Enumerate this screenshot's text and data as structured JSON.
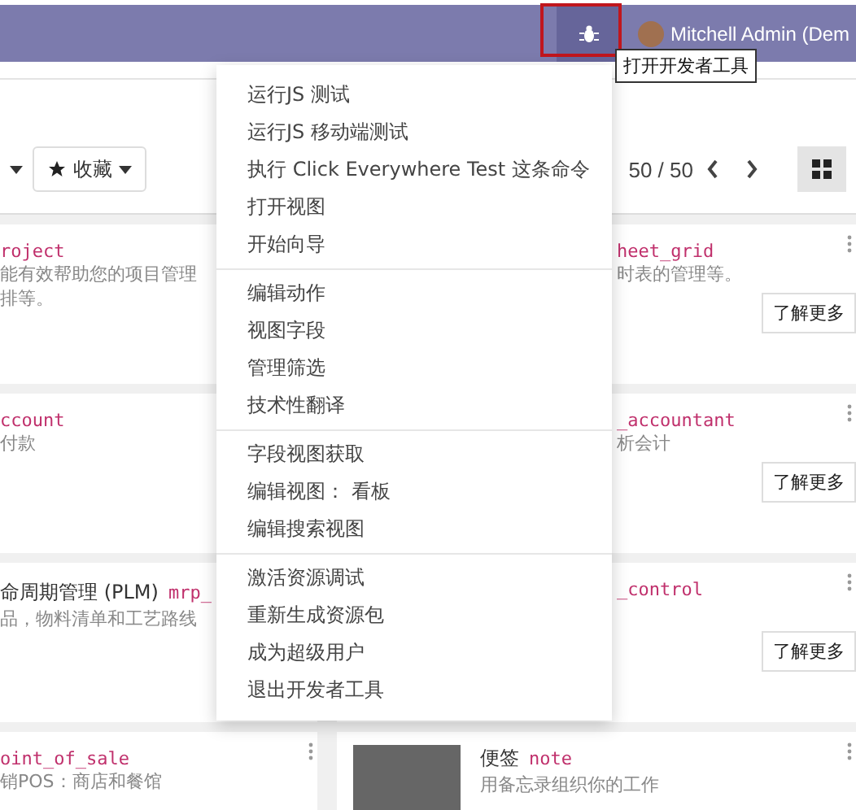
{
  "navbar": {
    "user": "Mitchell Admin (Dem",
    "tooltip": "打开开发者工具"
  },
  "toolbar": {
    "favorites": "收藏",
    "pager": "50 / 50"
  },
  "cards": [
    {
      "left": {
        "module": "roject",
        "description": "能有效帮助您的项目管理",
        "description_2": "排等。"
      },
      "right": {
        "kind": "partial",
        "module": "heet_grid",
        "description": "时表的管理等。",
        "button": "了解更多"
      }
    },
    {
      "left": {
        "module": "ccount",
        "description": "付款"
      },
      "right": {
        "kind": "partial",
        "module": "_accountant",
        "description": "析会计",
        "button": "了解更多"
      }
    },
    {
      "left": {
        "title": "命周期管理 (PLM)",
        "module": "mrp_",
        "description": "品，物料清单和工艺路线"
      },
      "right": {
        "kind": "partial",
        "module": "_control",
        "button": "了解更多"
      }
    },
    {
      "left": {
        "module": "oint_of_sale",
        "description": "销POS：商店和餐馆"
      },
      "right": {
        "kind": "image",
        "title": "便签",
        "module": "note",
        "description": "用备忘录组织你的工作"
      }
    }
  ],
  "debug_menu": [
    {
      "items": [
        "运行JS 测试",
        "运行JS 移动端测试",
        "执行 Click Everywhere Test 这条命令",
        "打开视图",
        "开始向导"
      ]
    },
    {
      "items": [
        "编辑动作",
        "视图字段",
        "管理筛选",
        "技术性翻译"
      ]
    },
    {
      "items": [
        "字段视图获取",
        "编辑视图： 看板",
        "编辑搜索视图"
      ]
    },
    {
      "items": [
        "激活资源调试",
        "重新生成资源包",
        "成为超级用户",
        "退出开发者工具"
      ]
    }
  ]
}
